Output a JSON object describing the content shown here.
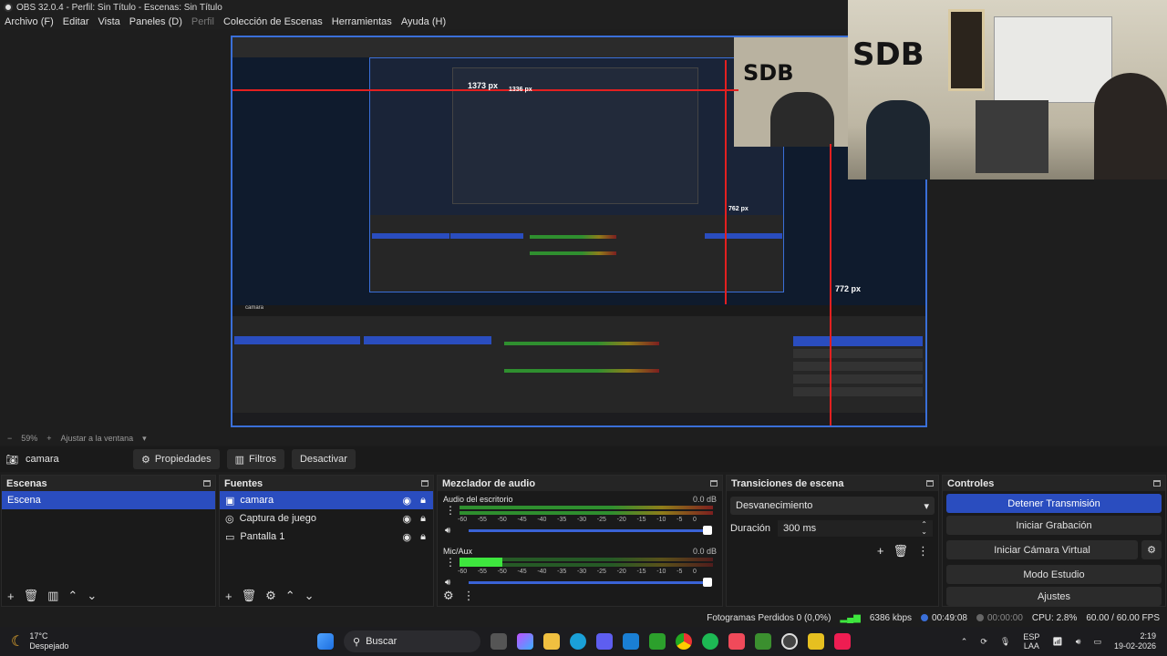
{
  "window": {
    "title": "OBS 32.0.4 - Perfil: Sin Título - Escenas: Sin Título"
  },
  "menu": [
    {
      "label": "Archivo (F)",
      "enabled": true
    },
    {
      "label": "Editar",
      "enabled": true
    },
    {
      "label": "Vista",
      "enabled": true
    },
    {
      "label": "Paneles (D)",
      "enabled": true
    },
    {
      "label": "Perfil",
      "enabled": false
    },
    {
      "label": "Colección de Escenas",
      "enabled": true
    },
    {
      "label": "Herramientas",
      "enabled": true
    },
    {
      "label": "Ayuda (H)",
      "enabled": true
    }
  ],
  "preview": {
    "measure_1373": "1373 px",
    "measure_1336": "1336 px",
    "measure_762": "762 px",
    "measure_772": "772 px",
    "webcam_wall_text": "SDB"
  },
  "zoom": {
    "percent": "59%",
    "fit_label": "Ajustar a la ventana"
  },
  "source_toolbar": {
    "source_name": "camara",
    "properties": "Propiedades",
    "filters": "Filtros",
    "deactivate": "Desactivar"
  },
  "scenes": {
    "title": "Escenas",
    "items": [
      "Escena"
    ]
  },
  "sources": {
    "title": "Fuentes",
    "items": [
      {
        "name": "camara",
        "icon": "camera-icon"
      },
      {
        "name": "Captura de juego",
        "icon": "gamepad-icon"
      },
      {
        "name": "Pantalla 1",
        "icon": "monitor-icon"
      }
    ]
  },
  "mixer": {
    "title": "Mezclador de audio",
    "channels": [
      {
        "name": "Audio del escritorio",
        "db": "0.0 dB",
        "level": 0.0
      },
      {
        "name": "Mic/Aux",
        "db": "0.0 dB",
        "level": 0.17
      }
    ],
    "ticks": [
      "-60",
      "-55",
      "-50",
      "-45",
      "-40",
      "-35",
      "-30",
      "-25",
      "-20",
      "-15",
      "-10",
      "-5",
      "0"
    ]
  },
  "transitions": {
    "title": "Transiciones de escena",
    "selected": "Desvanecimiento",
    "duration_label": "Duración",
    "duration_value": "300 ms"
  },
  "controls": {
    "title": "Controles",
    "buttons": {
      "stop_stream": "Detener Transmisión",
      "start_recording": "Iniciar Grabación",
      "virtual_cam": "Iniciar Cámara Virtual",
      "studio_mode": "Modo Estudio",
      "settings": "Ajustes"
    }
  },
  "status": {
    "dropped": "Fotogramas Perdidos 0 (0,0%)",
    "bitrate": "6386 kbps",
    "stream_time": "00:49:08",
    "rec_time": "00:00:00",
    "cpu": "CPU: 2.8%",
    "fps": "60.00 / 60.00 FPS"
  },
  "taskbar": {
    "weather_temp": "17°C",
    "weather_desc": "Despejado",
    "search": "Buscar",
    "lang": "ESP",
    "lang2": "LAA",
    "time": "2:19",
    "date": "19-02-2026"
  },
  "colors": {
    "accent": "#2a4dbf",
    "outline": "#3a6fd8",
    "measure": "#e32020"
  }
}
